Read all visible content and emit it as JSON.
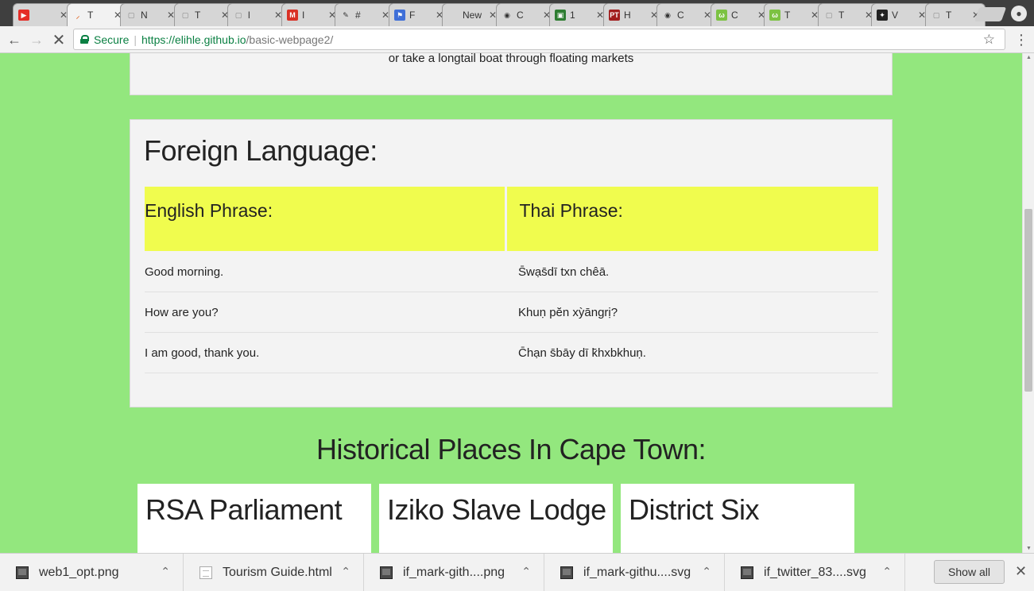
{
  "browser": {
    "tabs": [
      {
        "label": "",
        "icon": "youtube-icon",
        "color": "#e52d27",
        "glyph": "▶"
      },
      {
        "label": "T",
        "icon": "loading-icon",
        "color": "#e06a2b",
        "glyph": "⸝"
      },
      {
        "label": "N",
        "icon": "page-icon",
        "color": "#888888",
        "glyph": "▢"
      },
      {
        "label": "T",
        "icon": "page-icon",
        "color": "#888888",
        "glyph": "▢"
      },
      {
        "label": "l",
        "icon": "page-icon",
        "color": "#888888",
        "glyph": "▢"
      },
      {
        "label": "I",
        "icon": "gmail-icon",
        "color": "#d93025",
        "glyph": "M"
      },
      {
        "label": "#",
        "icon": "pen-icon",
        "color": "#333333",
        "glyph": "✎"
      },
      {
        "label": "F",
        "icon": "flag-icon",
        "color": "#3f6fd8",
        "glyph": "⚑"
      },
      {
        "label": "New",
        "icon": "none",
        "color": "#d6d6d6",
        "glyph": ""
      },
      {
        "label": "C",
        "icon": "eye-icon",
        "color": "#333333",
        "glyph": "◉"
      },
      {
        "label": "1",
        "icon": "terminal-icon",
        "color": "#2e7d32",
        "glyph": "▣"
      },
      {
        "label": "H",
        "icon": "pt-icon",
        "color": "#a11d1d",
        "glyph": "PT"
      },
      {
        "label": "C",
        "icon": "eye-icon",
        "color": "#333333",
        "glyph": "◉"
      },
      {
        "label": "C",
        "icon": "code-icon",
        "color": "#7cc242",
        "glyph": "ω"
      },
      {
        "label": "T",
        "icon": "code-icon",
        "color": "#7cc242",
        "glyph": "ω"
      },
      {
        "label": "T",
        "icon": "page-icon",
        "color": "#888888",
        "glyph": "▢"
      },
      {
        "label": "V",
        "icon": "vector-icon",
        "color": "#222222",
        "glyph": "✦"
      },
      {
        "label": "T",
        "icon": "page-icon",
        "color": "#888888",
        "glyph": "▢"
      }
    ],
    "secure_label": "Secure",
    "url_host": "https://elihle.github.io",
    "url_path": "/basic-webpage2/"
  },
  "page": {
    "top_card_text": "or take a longtail boat through floating markets",
    "language_title": "Foreign Language:",
    "table_headers": [
      "English Phrase:",
      "Thai Phrase:"
    ],
    "phrases": [
      {
        "english": "Good morning.",
        "thai": "S̄wạs̄dī txn chêā."
      },
      {
        "english": "How are you?",
        "thai": "Khuṇ pĕn xỳāngrị?"
      },
      {
        "english": "I am good, thank you.",
        "thai": "C̄hạn s̄bāy dī k̄hxbkhuṇ."
      }
    ],
    "historical_title": "Historical Places In Cape Town:",
    "places": [
      "RSA Parliament",
      "Iziko Slave Lodge",
      "District Six"
    ]
  },
  "downloads": {
    "items": [
      {
        "name": "web1_opt.png",
        "type": "img"
      },
      {
        "name": "Tourism Guide.html",
        "type": "doc"
      },
      {
        "name": "if_mark-gith....png",
        "type": "img"
      },
      {
        "name": "if_mark-githu....svg",
        "type": "img"
      },
      {
        "name": "if_twitter_83....svg",
        "type": "img"
      }
    ],
    "show_all_label": "Show all"
  },
  "colors": {
    "page_background": "#93e77e",
    "table_header": "#f0fc4e",
    "card": "#f3f3f3"
  }
}
